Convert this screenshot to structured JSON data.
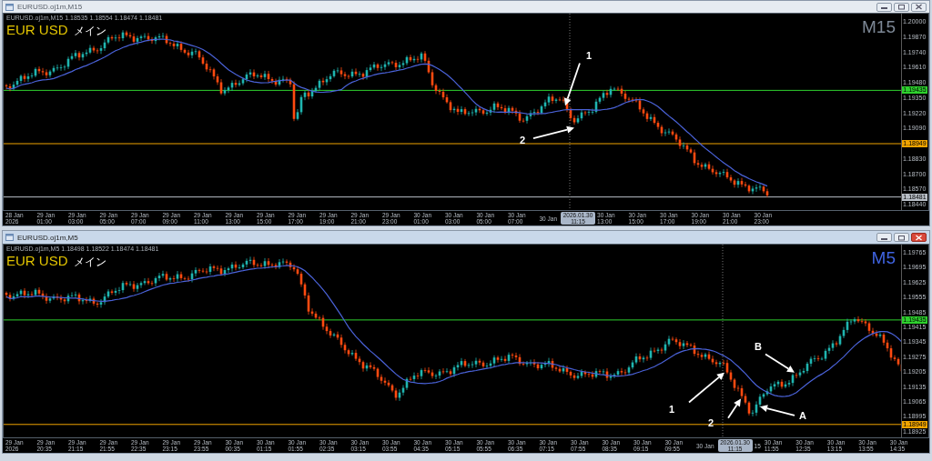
{
  "windows": [
    {
      "title": "EURUSD.oj1m,M15",
      "active": false,
      "info": "EURUSD.oj1m,M15  1.18535 1.18554 1.18474 1.18481",
      "symbol": "EUR USD",
      "label": "メイン",
      "timeframe": {
        "text": "M15",
        "color": "#7d8896"
      },
      "price_ticks": [
        "1.20000",
        "1.19870",
        "1.19740",
        "1.19610",
        "1.19480",
        "1.19350",
        "1.19220",
        "1.19090",
        "1.18830",
        "1.18700",
        "1.18570",
        "1.18440"
      ],
      "price_tags": [
        {
          "text": "1.19435",
          "color": "#2ed12e"
        },
        {
          "text": "1.18949",
          "color": "#f0a400"
        },
        {
          "text": "1.18481",
          "color": "#b8bec6"
        }
      ],
      "annotations": [
        {
          "text": "1"
        },
        {
          "text": "2"
        }
      ],
      "time_labels": [
        {
          "text": "28 Jan 2026",
          "kind": "tick"
        },
        {
          "text": "29 Jan 01:00",
          "kind": "tick"
        },
        {
          "text": "29 Jan 03:00",
          "kind": "tick"
        },
        {
          "text": "29 Jan 05:00",
          "kind": "tick"
        },
        {
          "text": "29 Jan 07:00",
          "kind": "tick"
        },
        {
          "text": "29 Jan 09:00",
          "kind": "tick"
        },
        {
          "text": "29 Jan 11:00",
          "kind": "tick"
        },
        {
          "text": "29 Jan 13:00",
          "kind": "tick"
        },
        {
          "text": "29 Jan 15:00",
          "kind": "tick"
        },
        {
          "text": "29 Jan 17:00",
          "kind": "tick"
        },
        {
          "text": "29 Jan 19:00",
          "kind": "tick"
        },
        {
          "text": "29 Jan 21:00",
          "kind": "tick"
        },
        {
          "text": "29 Jan 23:00",
          "kind": "tick"
        },
        {
          "text": "30 Jan 01:00",
          "kind": "tick"
        },
        {
          "text": "30 Jan 03:00",
          "kind": "tick"
        },
        {
          "text": "30 Jan 05:00",
          "kind": "tick"
        },
        {
          "text": "30 Jan 07:00",
          "kind": "tick"
        },
        {
          "text": "30 Jan",
          "kind": "fragment"
        },
        {
          "text": "2026.01.30 11:15",
          "kind": "cursor"
        },
        {
          "text": "30 Jan 13:00",
          "kind": "tick"
        },
        {
          "text": "30 Jan 15:00",
          "kind": "tick"
        },
        {
          "text": "30 Jan 17:00",
          "kind": "tick"
        },
        {
          "text": "30 Jan 19:00",
          "kind": "tick"
        },
        {
          "text": "30 Jan 21:00",
          "kind": "tick"
        },
        {
          "text": "30 Jan 23:00",
          "kind": "tick"
        }
      ]
    },
    {
      "title": "EURUSD.oj1m,M5",
      "active": true,
      "info": "EURUSD.oj1m,M5  1.18498 1.18522 1.18474 1.18481",
      "symbol": "EUR USD",
      "label": "メイン",
      "timeframe": {
        "text": "M5",
        "color": "#3f63e0"
      },
      "price_ticks": [
        "1.19765",
        "1.19695",
        "1.19625",
        "1.19555",
        "1.19485",
        "1.19415",
        "1.19345",
        "1.19275",
        "1.19205",
        "1.19135",
        "1.19065",
        "1.18995",
        "1.18925"
      ],
      "price_tags": [
        {
          "text": "1.19435",
          "color": "#2ed12e"
        },
        {
          "text": "1.18949",
          "color": "#f0a400"
        }
      ],
      "annotations": [
        {
          "text": "1"
        },
        {
          "text": "2"
        },
        {
          "text": "A"
        },
        {
          "text": "B"
        }
      ],
      "time_labels": [
        {
          "text": "29 Jan 2026",
          "kind": "tick"
        },
        {
          "text": "29 Jan 20:35",
          "kind": "tick"
        },
        {
          "text": "29 Jan 21:15",
          "kind": "tick"
        },
        {
          "text": "29 Jan 21:55",
          "kind": "tick"
        },
        {
          "text": "29 Jan 22:35",
          "kind": "tick"
        },
        {
          "text": "29 Jan 23:15",
          "kind": "tick"
        },
        {
          "text": "29 Jan 23:55",
          "kind": "tick"
        },
        {
          "text": "30 Jan 00:35",
          "kind": "tick"
        },
        {
          "text": "30 Jan 01:15",
          "kind": "tick"
        },
        {
          "text": "30 Jan 01:55",
          "kind": "tick"
        },
        {
          "text": "30 Jan 02:35",
          "kind": "tick"
        },
        {
          "text": "30 Jan 03:15",
          "kind": "tick"
        },
        {
          "text": "30 Jan 03:55",
          "kind": "tick"
        },
        {
          "text": "30 Jan 04:35",
          "kind": "tick"
        },
        {
          "text": "30 Jan 05:15",
          "kind": "tick"
        },
        {
          "text": "30 Jan 05:55",
          "kind": "tick"
        },
        {
          "text": "30 Jan 06:35",
          "kind": "tick"
        },
        {
          "text": "30 Jan 07:15",
          "kind": "tick"
        },
        {
          "text": "30 Jan 07:55",
          "kind": "tick"
        },
        {
          "text": "30 Jan 08:35",
          "kind": "tick"
        },
        {
          "text": "30 Jan 09:15",
          "kind": "tick"
        },
        {
          "text": "30 Jan 09:55",
          "kind": "tick"
        },
        {
          "text": "30 Jan",
          "kind": "fragment"
        },
        {
          "text": "2026.01.30 11:15",
          "kind": "cursor"
        },
        {
          "text": "15",
          "kind": "fragment"
        },
        {
          "text": "30 Jan 11:55",
          "kind": "tick"
        },
        {
          "text": "30 Jan 12:35",
          "kind": "tick"
        },
        {
          "text": "30 Jan 13:15",
          "kind": "tick"
        },
        {
          "text": "30 Jan 13:55",
          "kind": "tick"
        },
        {
          "text": "30 Jan 14:35",
          "kind": "tick"
        }
      ]
    }
  ]
}
